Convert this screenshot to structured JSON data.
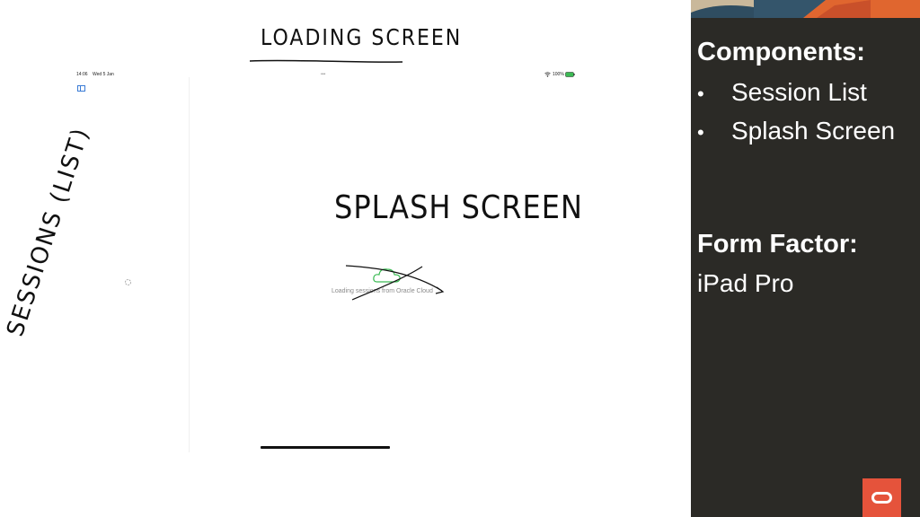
{
  "sketch": {
    "title": "LOADING SCREEN",
    "side_label": "SESSIONS (LIST)",
    "center_label": "SPLASH SCREEN",
    "loading_text": "Loading sessions from Oracle Cloud"
  },
  "status_bar": {
    "time": "14:06",
    "date": "Wed 5 Jan",
    "dots": "•••",
    "battery": "100%"
  },
  "panel": {
    "components_heading": "Components:",
    "components": [
      {
        "label": "Session List"
      },
      {
        "label": "Splash Screen"
      }
    ],
    "bullet": "•",
    "form_factor_heading": "Form Factor:",
    "form_factor_value": "iPad Pro"
  },
  "colors": {
    "panel_bg": "#2b2a26",
    "logo_bg": "#e5533b",
    "cloud_green": "#3cba54",
    "sidebar_icon": "#3a7bd5"
  },
  "icons": [
    "sidebar-toggle-icon",
    "wifi-icon",
    "battery-icon",
    "cloud-icon",
    "loading-spinner-icon",
    "oracle-logo-icon"
  ]
}
